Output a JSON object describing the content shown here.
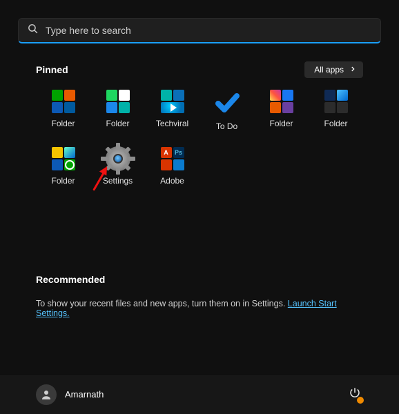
{
  "search": {
    "placeholder": "Type here to search"
  },
  "pinned": {
    "title": "Pinned",
    "all_apps_label": "All apps",
    "items": [
      {
        "label": "Folder"
      },
      {
        "label": "Folder"
      },
      {
        "label": "Techviral"
      },
      {
        "label": "To Do"
      },
      {
        "label": "Folder"
      },
      {
        "label": "Folder"
      },
      {
        "label": "Folder"
      },
      {
        "label": "Settings"
      },
      {
        "label": "Adobe"
      }
    ]
  },
  "recommended": {
    "title": "Recommended",
    "text": "To show your recent files and new apps, turn them on in Settings. ",
    "link_text": "Launch Start Settings."
  },
  "footer": {
    "username": "Amarnath"
  }
}
